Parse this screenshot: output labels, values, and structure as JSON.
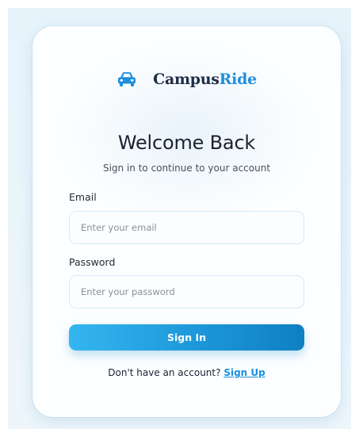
{
  "brand": {
    "name_part1": "Campus",
    "name_part2": "Ride",
    "icon": "car-icon",
    "accent_color": "#1f8fe0"
  },
  "header": {
    "title": "Welcome Back",
    "subtitle": "Sign in to continue to your account"
  },
  "form": {
    "email_label": "Email",
    "email_placeholder": "Enter your email",
    "email_value": "",
    "password_label": "Password",
    "password_placeholder": "Enter your password",
    "password_value": "",
    "submit_label": "Sign In"
  },
  "footer": {
    "prompt": "Don't have an account?",
    "link_label": "Sign Up"
  }
}
